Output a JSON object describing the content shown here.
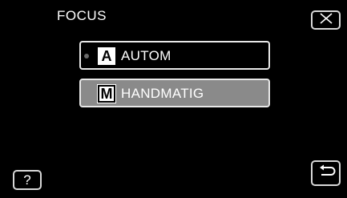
{
  "menu": {
    "title": "FOCUS",
    "options": [
      {
        "badge": "A",
        "label": "AUTOM",
        "selected_indicator": true
      },
      {
        "badge": "M",
        "label": "HANDMATIG",
        "highlighted": true
      }
    ]
  },
  "buttons": {
    "close_icon": "close-x-icon",
    "help_label": "?",
    "back_icon": "return-arrow-icon"
  },
  "colors": {
    "background": "#000000",
    "highlight": "#8a8a8a",
    "border": "#e8e8e8",
    "text": "#ffffff"
  }
}
